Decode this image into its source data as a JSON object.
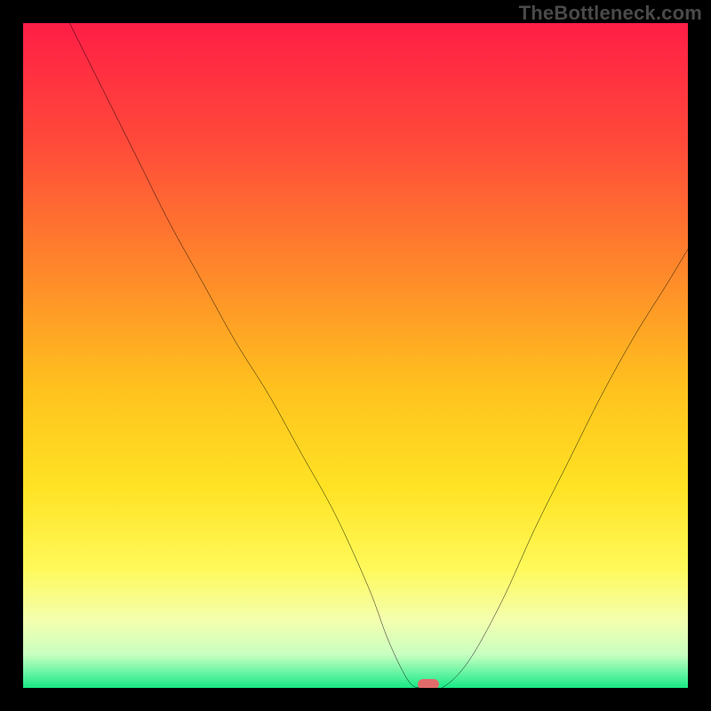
{
  "watermark": "TheBottleneck.com",
  "colors": {
    "frame": "#000000",
    "curve": "#000000",
    "marker": "#e06b6b",
    "gradient_stops": [
      {
        "pct": 0,
        "color": "#ff1e46"
      },
      {
        "pct": 18,
        "color": "#ff4a3a"
      },
      {
        "pct": 38,
        "color": "#ff8a2a"
      },
      {
        "pct": 55,
        "color": "#ffc21e"
      },
      {
        "pct": 70,
        "color": "#ffe324"
      },
      {
        "pct": 82,
        "color": "#fff95a"
      },
      {
        "pct": 90,
        "color": "#f3ffb0"
      },
      {
        "pct": 95,
        "color": "#c8ffc0"
      },
      {
        "pct": 98,
        "color": "#5ef3a0"
      },
      {
        "pct": 100,
        "color": "#18e885"
      }
    ]
  },
  "chart_data": {
    "type": "line",
    "title": "",
    "xlabel": "",
    "ylabel": "",
    "xlim": [
      0,
      100
    ],
    "ylim": [
      0,
      100
    ],
    "grid": false,
    "legend": false,
    "series": [
      {
        "name": "bottleneck-curve",
        "x": [
          7,
          12,
          17,
          22,
          27,
          32,
          37,
          42,
          47,
          52,
          55,
          58,
          60,
          63,
          67,
          72,
          77,
          82,
          87,
          92,
          97,
          100
        ],
        "y": [
          100,
          90,
          80,
          70,
          61,
          52,
          44,
          35,
          26,
          15,
          7,
          1,
          0,
          0,
          4,
          13,
          24,
          34,
          44,
          53,
          61,
          66
        ]
      }
    ],
    "annotations": [
      {
        "name": "optimal-marker",
        "x": 61,
        "y": 0.5,
        "shape": "pill",
        "color": "#e06b6b"
      }
    ]
  }
}
